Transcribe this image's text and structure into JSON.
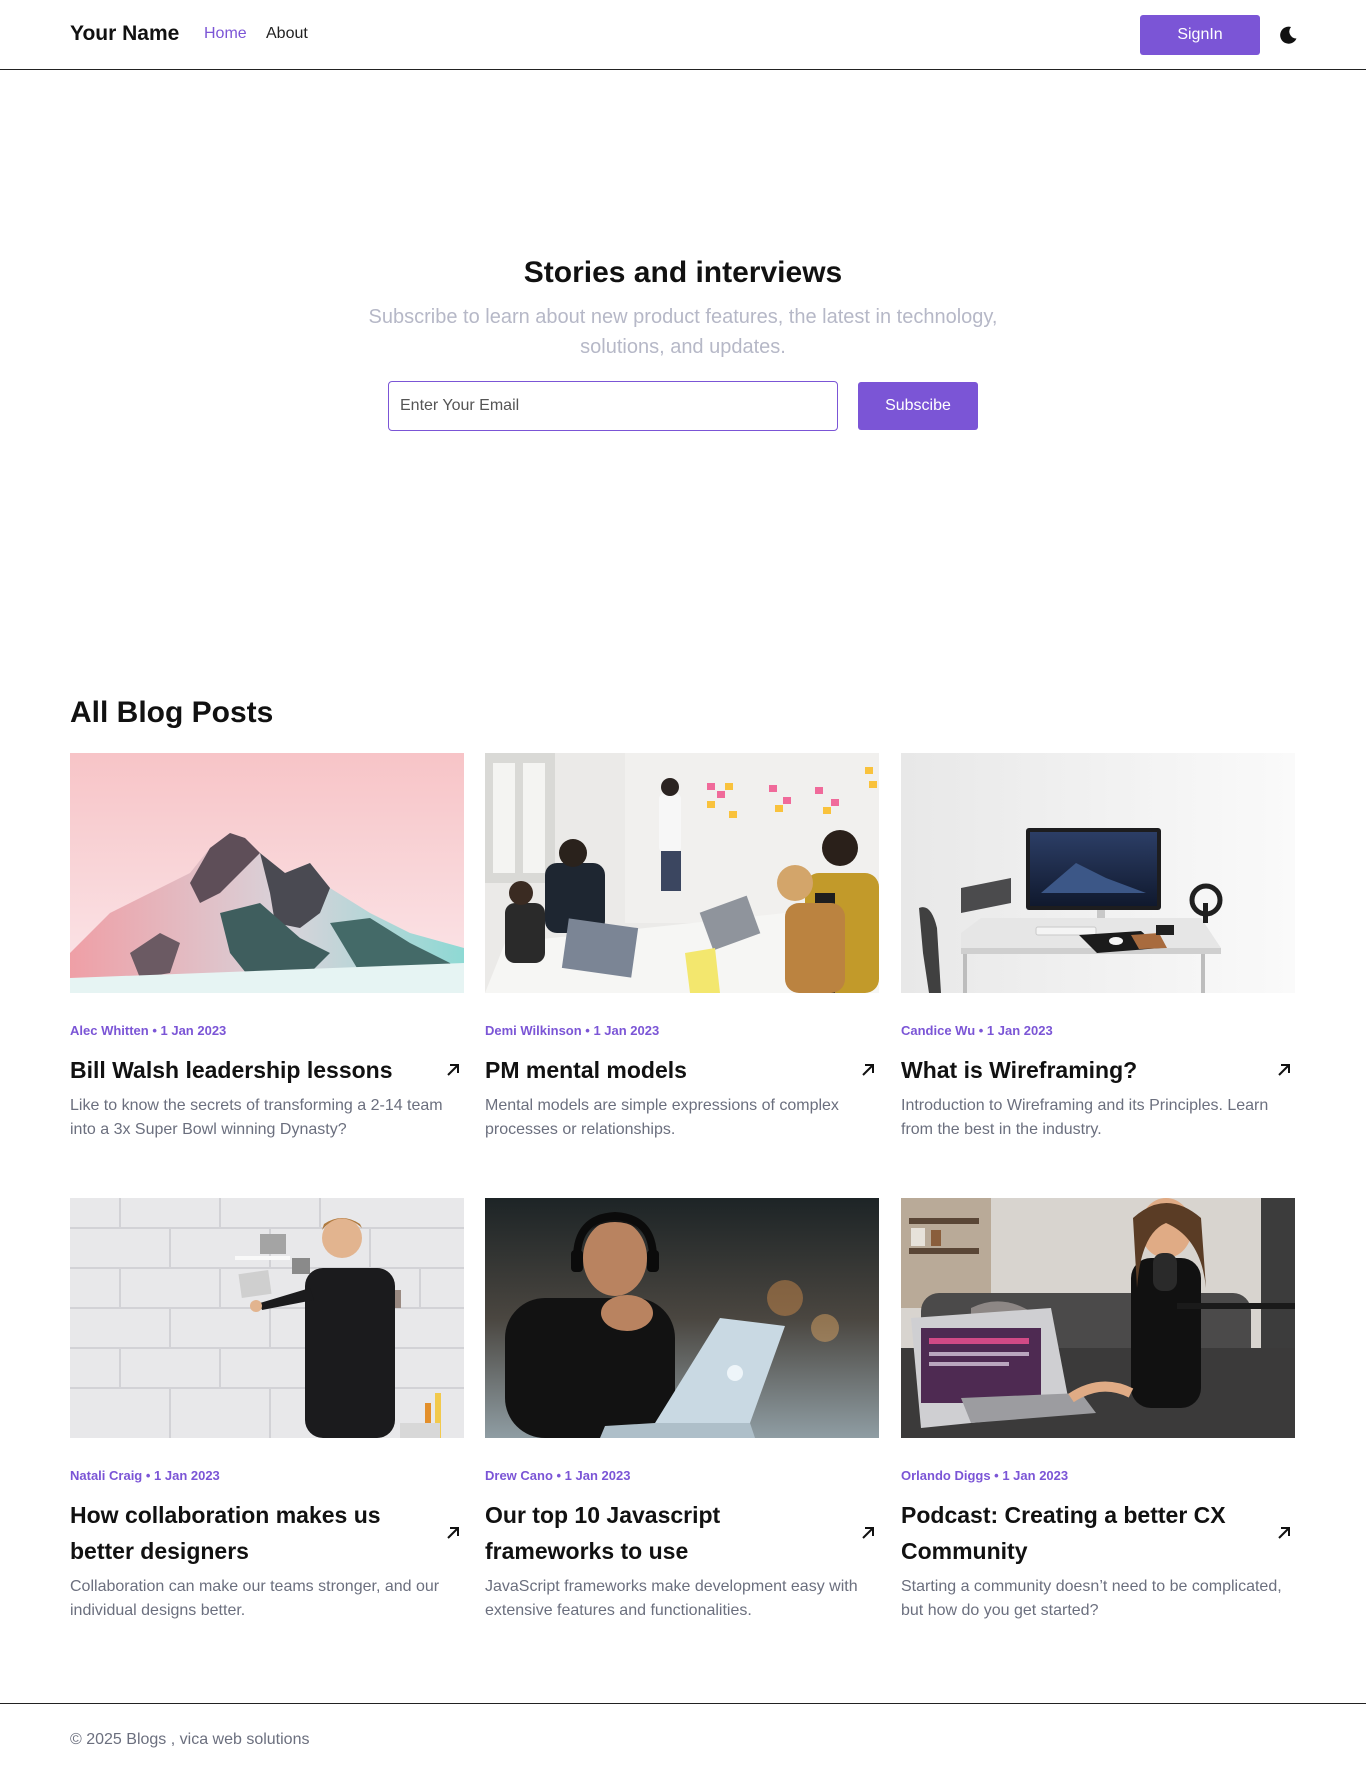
{
  "nav": {
    "brand": "Your Name",
    "links": [
      {
        "label": "Home",
        "active": true
      },
      {
        "label": "About",
        "active": false
      }
    ],
    "signin_label": "SignIn",
    "theme_icon": "moon-icon",
    "accent_color": "#7b55d6"
  },
  "hero": {
    "title": "Stories and interviews",
    "subtitle": "Subscribe to learn about new product features, the latest in technology, solutions, and updates.",
    "email_placeholder": "Enter Your Email",
    "subscribe_label": "Subscibe"
  },
  "blog": {
    "title": "All Blog Posts",
    "arrow_icon": "arrow-up-right-icon",
    "posts": [
      {
        "meta": "Alec Whitten • 1 Jan 2023",
        "title": "Bill Walsh leadership lessons",
        "description": "Like to know the secrets of transforming a 2-14 team into a 3x Super Bowl winning Dynasty?",
        "image": "snowy-mountain-photo"
      },
      {
        "meta": "Demi Wilkinson • 1 Jan 2023",
        "title": "PM mental models",
        "description": "Mental models are simple expressions of complex processes or relationships.",
        "image": "team-meeting-photo"
      },
      {
        "meta": "Candice Wu • 1 Jan 2023",
        "title": "What is Wireframing?",
        "description": "Introduction to Wireframing and its Principles. Learn from the best in the industry.",
        "image": "desk-monitor-photo"
      },
      {
        "meta": "Natali Craig • 1 Jan 2023",
        "title": "How collaboration makes us better designers",
        "description": "Collaboration can make our teams stronger, and our individual designs better.",
        "image": "wall-pinboard-photo"
      },
      {
        "meta": "Drew Cano • 1 Jan 2023",
        "title": "Our top 10 Javascript frameworks to use",
        "description": "JavaScript frameworks make development easy with extensive features and functionalities.",
        "image": "developer-laptop-photo"
      },
      {
        "meta": "Orlando Diggs • 1 Jan 2023",
        "title": "Podcast: Creating a better CX Community",
        "description": "Starting a community doesn’t need to be complicated, but how do you get started?",
        "image": "podcast-microphone-photo"
      }
    ]
  },
  "footer": {
    "text": "© 2025 Blogs , vica web solutions"
  }
}
